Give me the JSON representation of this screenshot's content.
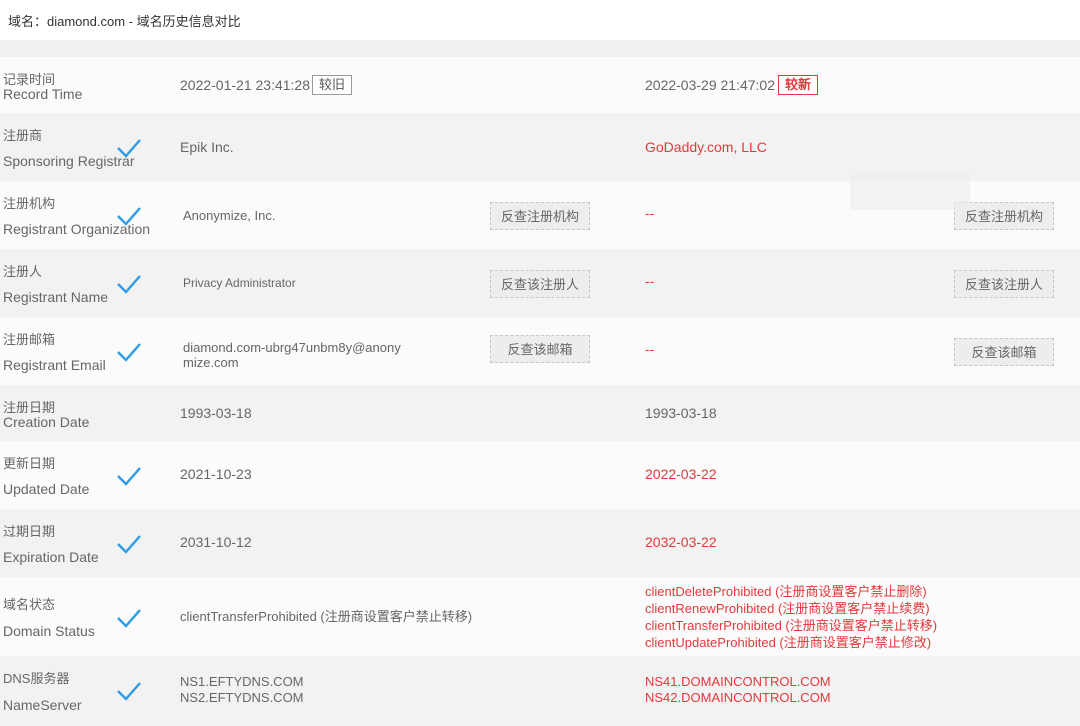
{
  "header": {
    "title": "域名：diamond.com - 域名历史信息对比"
  },
  "icons": {
    "check": "checkmark-icon",
    "check_color": "#2e9be6"
  },
  "colors": {
    "accent_red": "#e4393c",
    "check_blue": "#2e9be6"
  },
  "rows": {
    "record_time": {
      "label_cn": "记录时间",
      "label_en": "Record Time",
      "old": "2022-01-21 23:41:28",
      "old_tag": "较旧",
      "new": "2022-03-29 21:47:02",
      "new_tag": "较新"
    },
    "registrar": {
      "label_cn": "注册商",
      "label_en": "Sponsoring Registrar",
      "old": "Epik Inc.",
      "new": "GoDaddy.com, LLC"
    },
    "org": {
      "label_cn": "注册机构",
      "label_en": "Registrant Organization",
      "old": "Anonymize, Inc.",
      "old_button": "反查注册机构",
      "new": "--",
      "new_button": "反查注册机构"
    },
    "name": {
      "label_cn": "注册人",
      "label_en": "Registrant Name",
      "old": "Privacy Administrator",
      "old_button": "反查该注册人",
      "new": "--",
      "new_button": "反查该注册人"
    },
    "email": {
      "label_cn": "注册邮箱",
      "label_en": "Registrant Email",
      "old_line1": "diamond.com-ubrg47unbm8y@anony",
      "old_line2": "mize.com",
      "old_button": "反查该邮箱",
      "new": "--",
      "new_button": "反查该邮箱"
    },
    "creation": {
      "label_cn": "注册日期",
      "label_en": "Creation Date",
      "old": "1993-03-18",
      "new": "1993-03-18"
    },
    "updated": {
      "label_cn": "更新日期",
      "label_en": "Updated Date",
      "old": "2021-10-23",
      "new": "2022-03-22"
    },
    "expiration": {
      "label_cn": "过期日期",
      "label_en": "Expiration Date",
      "old": "2031-10-12",
      "new": "2032-03-22"
    },
    "status": {
      "label_cn": "域名状态",
      "label_en": "Domain Status",
      "old": "clientTransferProhibited (注册商设置客户禁止转移)",
      "new": [
        "clientDeleteProhibited (注册商设置客户禁止删除)",
        "clientRenewProhibited (注册商设置客户禁止续费)",
        "clientTransferProhibited (注册商设置客户禁止转移)",
        "clientUpdateProhibited (注册商设置客户禁止修改)"
      ]
    },
    "nameserver": {
      "label_cn": "DNS服务器",
      "label_en": "NameServer",
      "old": [
        "NS1.EFTYDNS.COM",
        "NS2.EFTYDNS.COM"
      ],
      "new": [
        "NS41.DOMAINCONTROL.COM",
        "NS42.DOMAINCONTROL.COM"
      ]
    }
  }
}
